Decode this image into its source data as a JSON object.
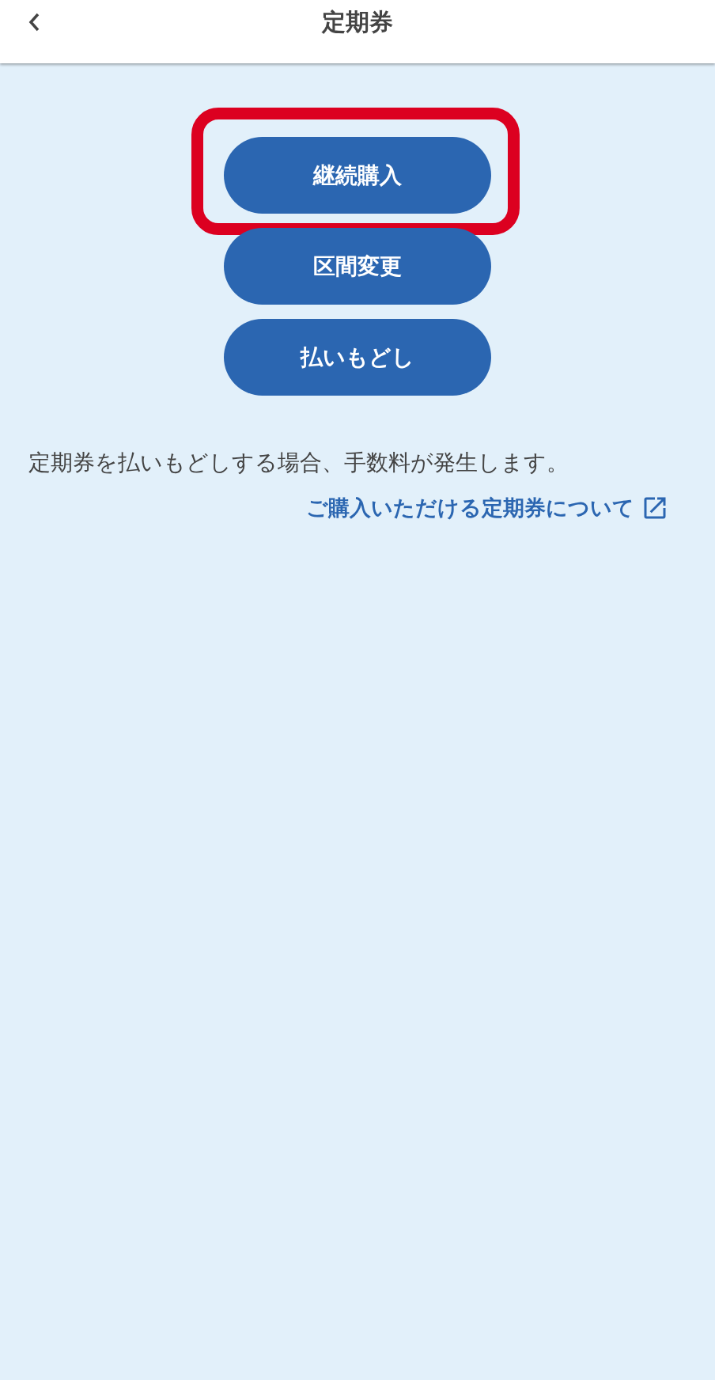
{
  "header": {
    "title": "定期券"
  },
  "buttons": [
    {
      "label": "継続購入",
      "highlighted": true
    },
    {
      "label": "区間変更",
      "highlighted": false
    },
    {
      "label": "払いもどし",
      "highlighted": false
    }
  ],
  "notice": "定期券を払いもどしする場合、手数料が発生します。",
  "link": {
    "label": "ご購入いただける定期券について"
  }
}
